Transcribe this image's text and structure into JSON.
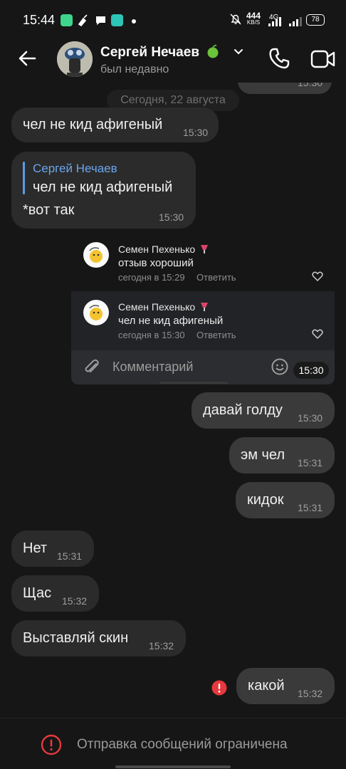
{
  "status_bar": {
    "time": "15:44",
    "net_speed_value": "444",
    "net_speed_unit": "KB/S",
    "network": "4G",
    "battery": "78"
  },
  "header": {
    "name": "Сергей Нечаев",
    "status": "был недавно",
    "name_emoji": "apple-icon"
  },
  "chat": {
    "prev_time": "15:30",
    "date_label": "Сегодня, 22 августа",
    "messages": [
      {
        "text": "чел не кид афигеный",
        "time": "15:30",
        "direction": "in"
      },
      {
        "reply_author": "Сергей Нечаев",
        "reply_text": "чел не кид афигеный",
        "text": "*вот так",
        "time": "15:30",
        "direction": "in"
      },
      {
        "text": "давай голду",
        "time": "15:30",
        "direction": "out"
      },
      {
        "text": "эм чел",
        "time": "15:31",
        "direction": "out"
      },
      {
        "text": "кидок",
        "time": "15:31",
        "direction": "out"
      },
      {
        "text": "Нет",
        "time": "15:31",
        "direction": "in"
      },
      {
        "text": "Щас",
        "time": "15:32",
        "direction": "in"
      },
      {
        "text": "Выставляй скин",
        "time": "15:32",
        "direction": "in"
      },
      {
        "text": "какой",
        "time": "15:32",
        "direction": "out",
        "error": true
      }
    ],
    "comments": [
      {
        "author": "Семен Пехенько",
        "text": "отзыв хороший",
        "meta": "сегодня в 15:29",
        "reply": "Ответить"
      },
      {
        "author": "Семен Пехенько",
        "text": "чел не кид афигеный",
        "meta": "сегодня в 15:30",
        "reply": "Ответить"
      }
    ],
    "comment_placeholder": "Комментарий",
    "comment_time_chip": "15:30"
  },
  "footer": {
    "restricted_text": "Отправка сообщений ограничена"
  },
  "colors": {
    "background": "#161616",
    "incoming_bubble": "#2b2b2b",
    "outgoing_bubble": "#3a3a3a",
    "link": "#6aa6ec",
    "error": "#e5393e"
  }
}
